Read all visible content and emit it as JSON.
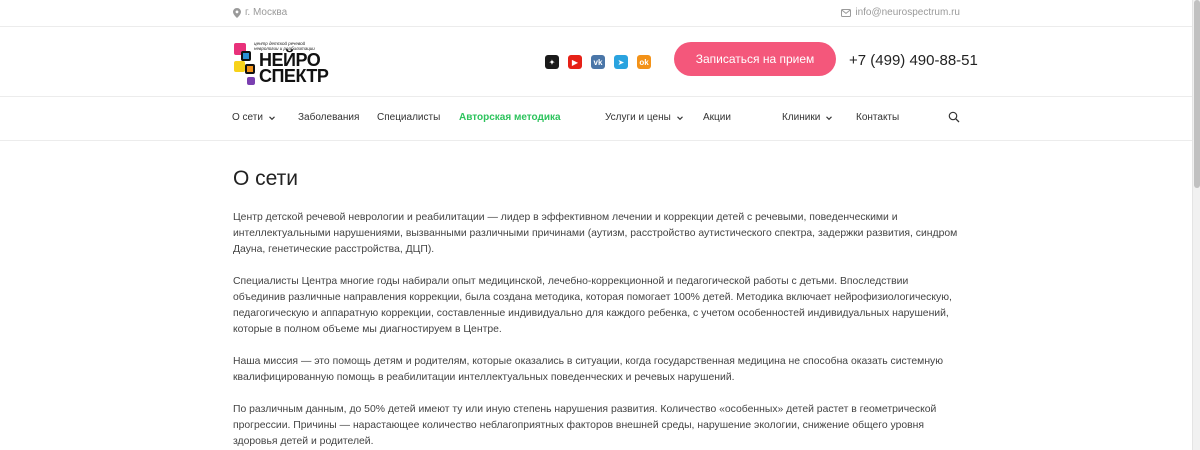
{
  "topbar": {
    "city": "г. Москва",
    "email": "info@neurospectrum.ru"
  },
  "logo": {
    "tagline": "центр детской речевой неврологии и реабилитации",
    "word1": "НЕЙРО",
    "word2": "СПЕКТР"
  },
  "socials": [
    {
      "name": "dzen",
      "color": "#1a1a1a",
      "glyph": "✦"
    },
    {
      "name": "youtube",
      "color": "#e62117",
      "glyph": "▶"
    },
    {
      "name": "vk",
      "color": "#4a76a8",
      "glyph": "vk"
    },
    {
      "name": "telegram",
      "color": "#2aa3df",
      "glyph": "➤"
    },
    {
      "name": "odnoklassniki",
      "color": "#f39218",
      "glyph": "ok"
    }
  ],
  "header": {
    "cta_label": "Записаться на прием",
    "phone": "+7 (499) 490-88-51",
    "cta_color": "#f4577b"
  },
  "nav": {
    "items": [
      {
        "label": "О сети",
        "dropdown": true
      },
      {
        "label": "Заболевания",
        "dropdown": false
      },
      {
        "label": "Специалисты",
        "dropdown": false
      },
      {
        "label": "Авторская методика",
        "dropdown": false,
        "accent": true
      },
      {
        "label": "Услуги и цены",
        "dropdown": true
      },
      {
        "label": "Акции",
        "dropdown": false
      },
      {
        "label": "Клиники",
        "dropdown": true
      },
      {
        "label": "Контакты",
        "dropdown": false
      }
    ],
    "accent_color": "#2cc35c"
  },
  "main": {
    "title": "О сети",
    "paragraphs": [
      "Центр детской речевой неврологии и реабилитации — лидер в эффективном лечении и коррекции детей с речевыми, поведенческими и интеллектуальными нарушениями, вызванными различными причинами (аутизм, расстройство аутистического спектра, задержки развития, синдром Дауна, генетические расстройства, ДЦП).",
      "Специалисты Центра многие годы набирали опыт медицинской, лечебно-коррекционной и педагогической работы с детьми. Впоследствии объединив различные направления коррекции, была создана методика, которая помогает 100% детей. Методика включает нейрофизиологическую, педагогическую и аппаратную коррекции, составленные индивидуально для каждого ребенка, с учетом особенностей индивидуальных нарушений, которые в полном объеме мы диагностируем в Центре.",
      "Наша миссия — это помощь детям и родителям, которые оказались в ситуации, когда государственная медицина не способна оказать системную квалифицированную помощь в реабилитации интеллектуальных поведенческих и речевых нарушений.",
      "По различным данным, до 50% детей имеют ту или иную степень нарушения развития. Количество «особенных» детей растет в геометрической прогрессии. Причины — нарастающее количество неблагоприятных факторов внешней среды, нарушение экологии, снижение общего уровня здоровья детей и родителей."
    ]
  }
}
